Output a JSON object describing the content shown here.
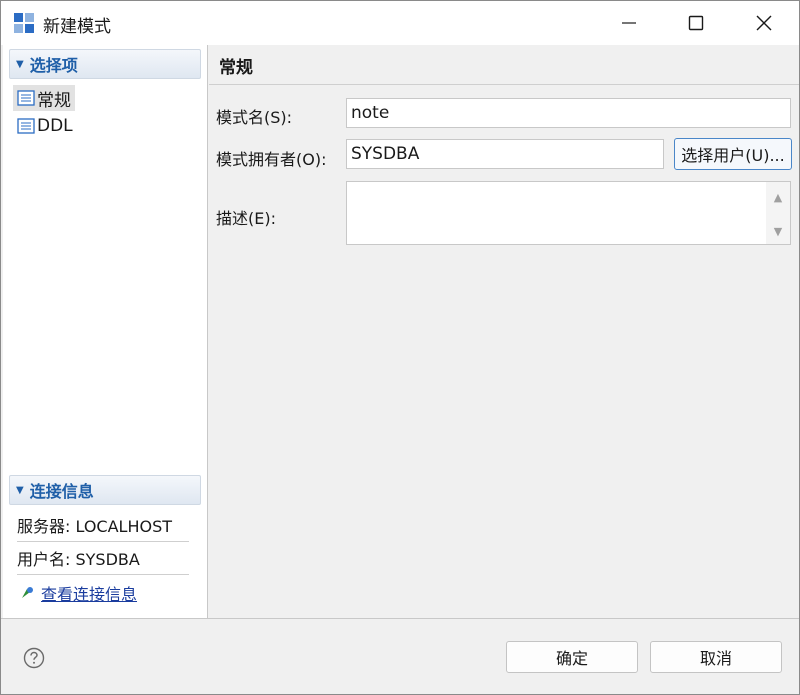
{
  "window": {
    "title": "新建模式",
    "app_icon": "schema-app-icon",
    "controls": {
      "minimize": "minimize-icon",
      "maximize": "maximize-icon",
      "close": "close-icon"
    }
  },
  "sidebar": {
    "selection_header": "选择项",
    "items": [
      {
        "label": "常规",
        "icon": "document-icon",
        "selected": true
      },
      {
        "label": "DDL",
        "icon": "document-icon",
        "selected": false
      }
    ],
    "connection_header": "连接信息",
    "server": "服务器: LOCALHOST",
    "user": "用户名: SYSDBA",
    "view_link": "查看连接信息"
  },
  "main": {
    "title": "常规",
    "fields": {
      "name_label": "模式名(S):",
      "name_value": "note",
      "owner_label": "模式拥有者(O):",
      "owner_value": "SYSDBA",
      "choose_user_button": "选择用户(U)...",
      "desc_label": "描述(E):",
      "desc_value": ""
    }
  },
  "footer": {
    "help_icon": "help-icon",
    "ok_label": "确定",
    "cancel_label": "取消"
  },
  "colors": {
    "accent": "#1f5fa8",
    "link": "#1a3c9e",
    "selected_bg": "#e2e2e2"
  }
}
